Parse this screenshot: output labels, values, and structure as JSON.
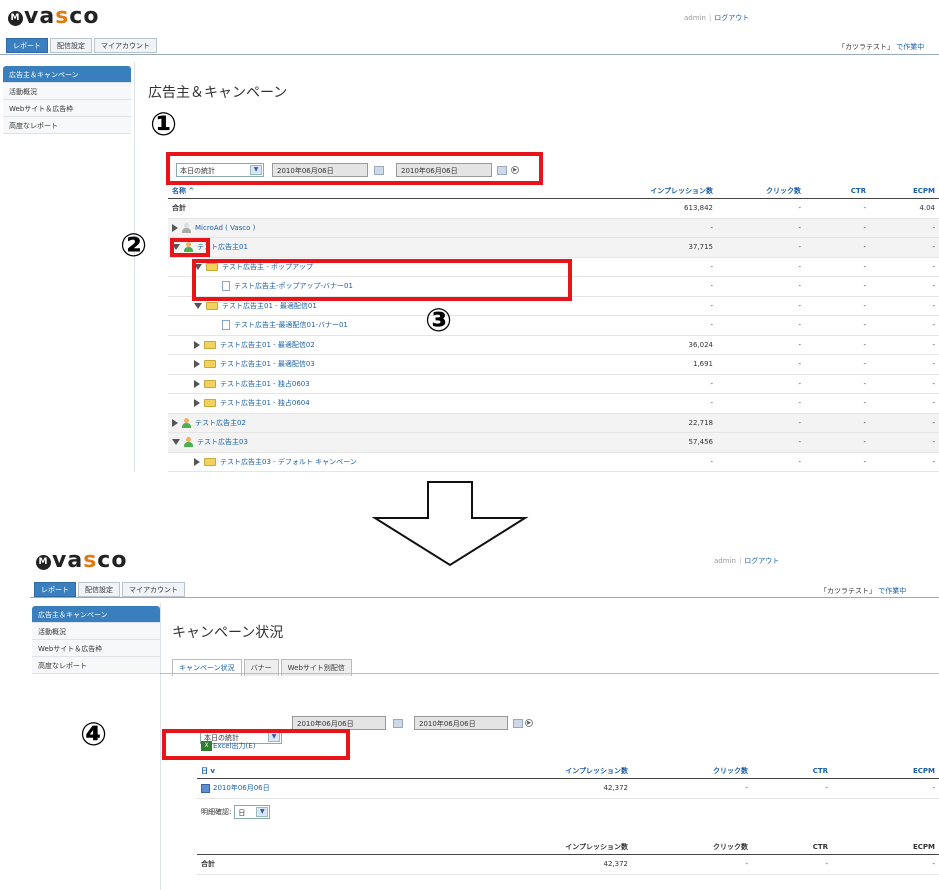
{
  "brand": {
    "logo_text": "vasco",
    "logo_mark": "M"
  },
  "header": {
    "user": "admin",
    "logout": "ログアウト"
  },
  "main_tabs": [
    "レポート",
    "配信設定",
    "マイアカウント"
  ],
  "project": {
    "label": "「カツラテスト」",
    "link": "で作業中"
  },
  "sidebar": [
    {
      "label": "広告主＆キャンペーン"
    },
    {
      "label": "活動概況"
    },
    {
      "label": "Webサイト＆広告枠"
    },
    {
      "label": "高度なレポート"
    }
  ],
  "screen1": {
    "title": "広告主＆キャンペーン",
    "filter": {
      "period": "本日の統計",
      "date_from": "2010年06月06日",
      "date_to": "2010年06月06日"
    },
    "columns": [
      "名称 ^",
      "インプレッション数",
      "クリック数",
      "CTR",
      "ECPM"
    ],
    "rows": [
      {
        "name": "合計",
        "impressions": "613,842",
        "clicks": "-",
        "ctr": "-",
        "ecpm": "4.04",
        "indent": 0,
        "icon": "none",
        "toggle": "none",
        "bold": true
      },
      {
        "name": "MicroAd ( Vasco )",
        "impressions": "-",
        "clicks": "-",
        "ctr": "-",
        "ecpm": "-",
        "indent": 0,
        "icon": "person-gray",
        "toggle": "r",
        "shade": true
      },
      {
        "name": "テスト広告主01",
        "impressions": "37,715",
        "clicks": "-",
        "ctr": "-",
        "ecpm": "-",
        "indent": 0,
        "icon": "person",
        "toggle": "d",
        "shade": true
      },
      {
        "name": "テスト広告主 - ポップアップ",
        "impressions": "-",
        "clicks": "-",
        "ctr": "-",
        "ecpm": "-",
        "indent": 1,
        "icon": "folder",
        "toggle": "d"
      },
      {
        "name": "テスト広告主-ポップアップ-バナー01",
        "impressions": "-",
        "clicks": "-",
        "ctr": "-",
        "ecpm": "-",
        "indent": 2,
        "icon": "doc",
        "toggle": "none"
      },
      {
        "name": "テスト広告主01 - 最適配信01",
        "impressions": "-",
        "clicks": "-",
        "ctr": "-",
        "ecpm": "-",
        "indent": 1,
        "icon": "folder",
        "toggle": "d"
      },
      {
        "name": "テスト広告主-最適配信01-バナー01",
        "impressions": "-",
        "clicks": "-",
        "ctr": "-",
        "ecpm": "-",
        "indent": 2,
        "icon": "doc",
        "toggle": "none"
      },
      {
        "name": "テスト広告主01 - 最適配信02",
        "impressions": "36,024",
        "clicks": "-",
        "ctr": "-",
        "ecpm": "-",
        "indent": 1,
        "icon": "folder",
        "toggle": "r"
      },
      {
        "name": "テスト広告主01 - 最適配信03",
        "impressions": "1,691",
        "clicks": "-",
        "ctr": "-",
        "ecpm": "-",
        "indent": 1,
        "icon": "folder",
        "toggle": "r"
      },
      {
        "name": "テスト広告主01 - 独占0603",
        "impressions": "-",
        "clicks": "-",
        "ctr": "-",
        "ecpm": "-",
        "indent": 1,
        "icon": "folder",
        "toggle": "r"
      },
      {
        "name": "テスト広告主01 - 独占0604",
        "impressions": "-",
        "clicks": "-",
        "ctr": "-",
        "ecpm": "-",
        "indent": 1,
        "icon": "folder",
        "toggle": "r"
      },
      {
        "name": "テスト広告主02",
        "impressions": "22,718",
        "clicks": "-",
        "ctr": "-",
        "ecpm": "-",
        "indent": 0,
        "icon": "person",
        "toggle": "r",
        "shade": true
      },
      {
        "name": "テスト広告主03",
        "impressions": "57,456",
        "clicks": "-",
        "ctr": "-",
        "ecpm": "-",
        "indent": 0,
        "icon": "person",
        "toggle": "d",
        "shade": true
      },
      {
        "name": "テスト広告主03 - デフォルト キャンペーン",
        "impressions": "-",
        "clicks": "-",
        "ctr": "-",
        "ecpm": "-",
        "indent": 1,
        "icon": "folder",
        "toggle": "r"
      }
    ]
  },
  "screen2": {
    "title": "キャンペーン状況",
    "subtabs": [
      "キャンペーン状況",
      "バナー",
      "Webサイト別配信"
    ],
    "filter": {
      "period": "本日の統計",
      "date_from": "2010年06月06日",
      "date_to": "2010年06月06日"
    },
    "excel": "Excel出力(E)",
    "columns": [
      "日 v",
      "インプレッション数",
      "クリック数",
      "CTR",
      "ECPM"
    ],
    "rows": [
      {
        "date": "2010年06月06日",
        "impressions": "42,372",
        "clicks": "-",
        "ctr": "-",
        "ecpm": "-"
      }
    ],
    "detail_label": "明細確認:",
    "detail_value": "日",
    "total_columns": [
      "",
      "インプレッション数",
      "クリック数",
      "CTR",
      "ECPM"
    ],
    "total_row": {
      "label": "合計",
      "impressions": "42,372",
      "clicks": "-",
      "ctr": "-",
      "ecpm": "-"
    }
  },
  "markers": [
    "①",
    "②",
    "③",
    "④"
  ]
}
